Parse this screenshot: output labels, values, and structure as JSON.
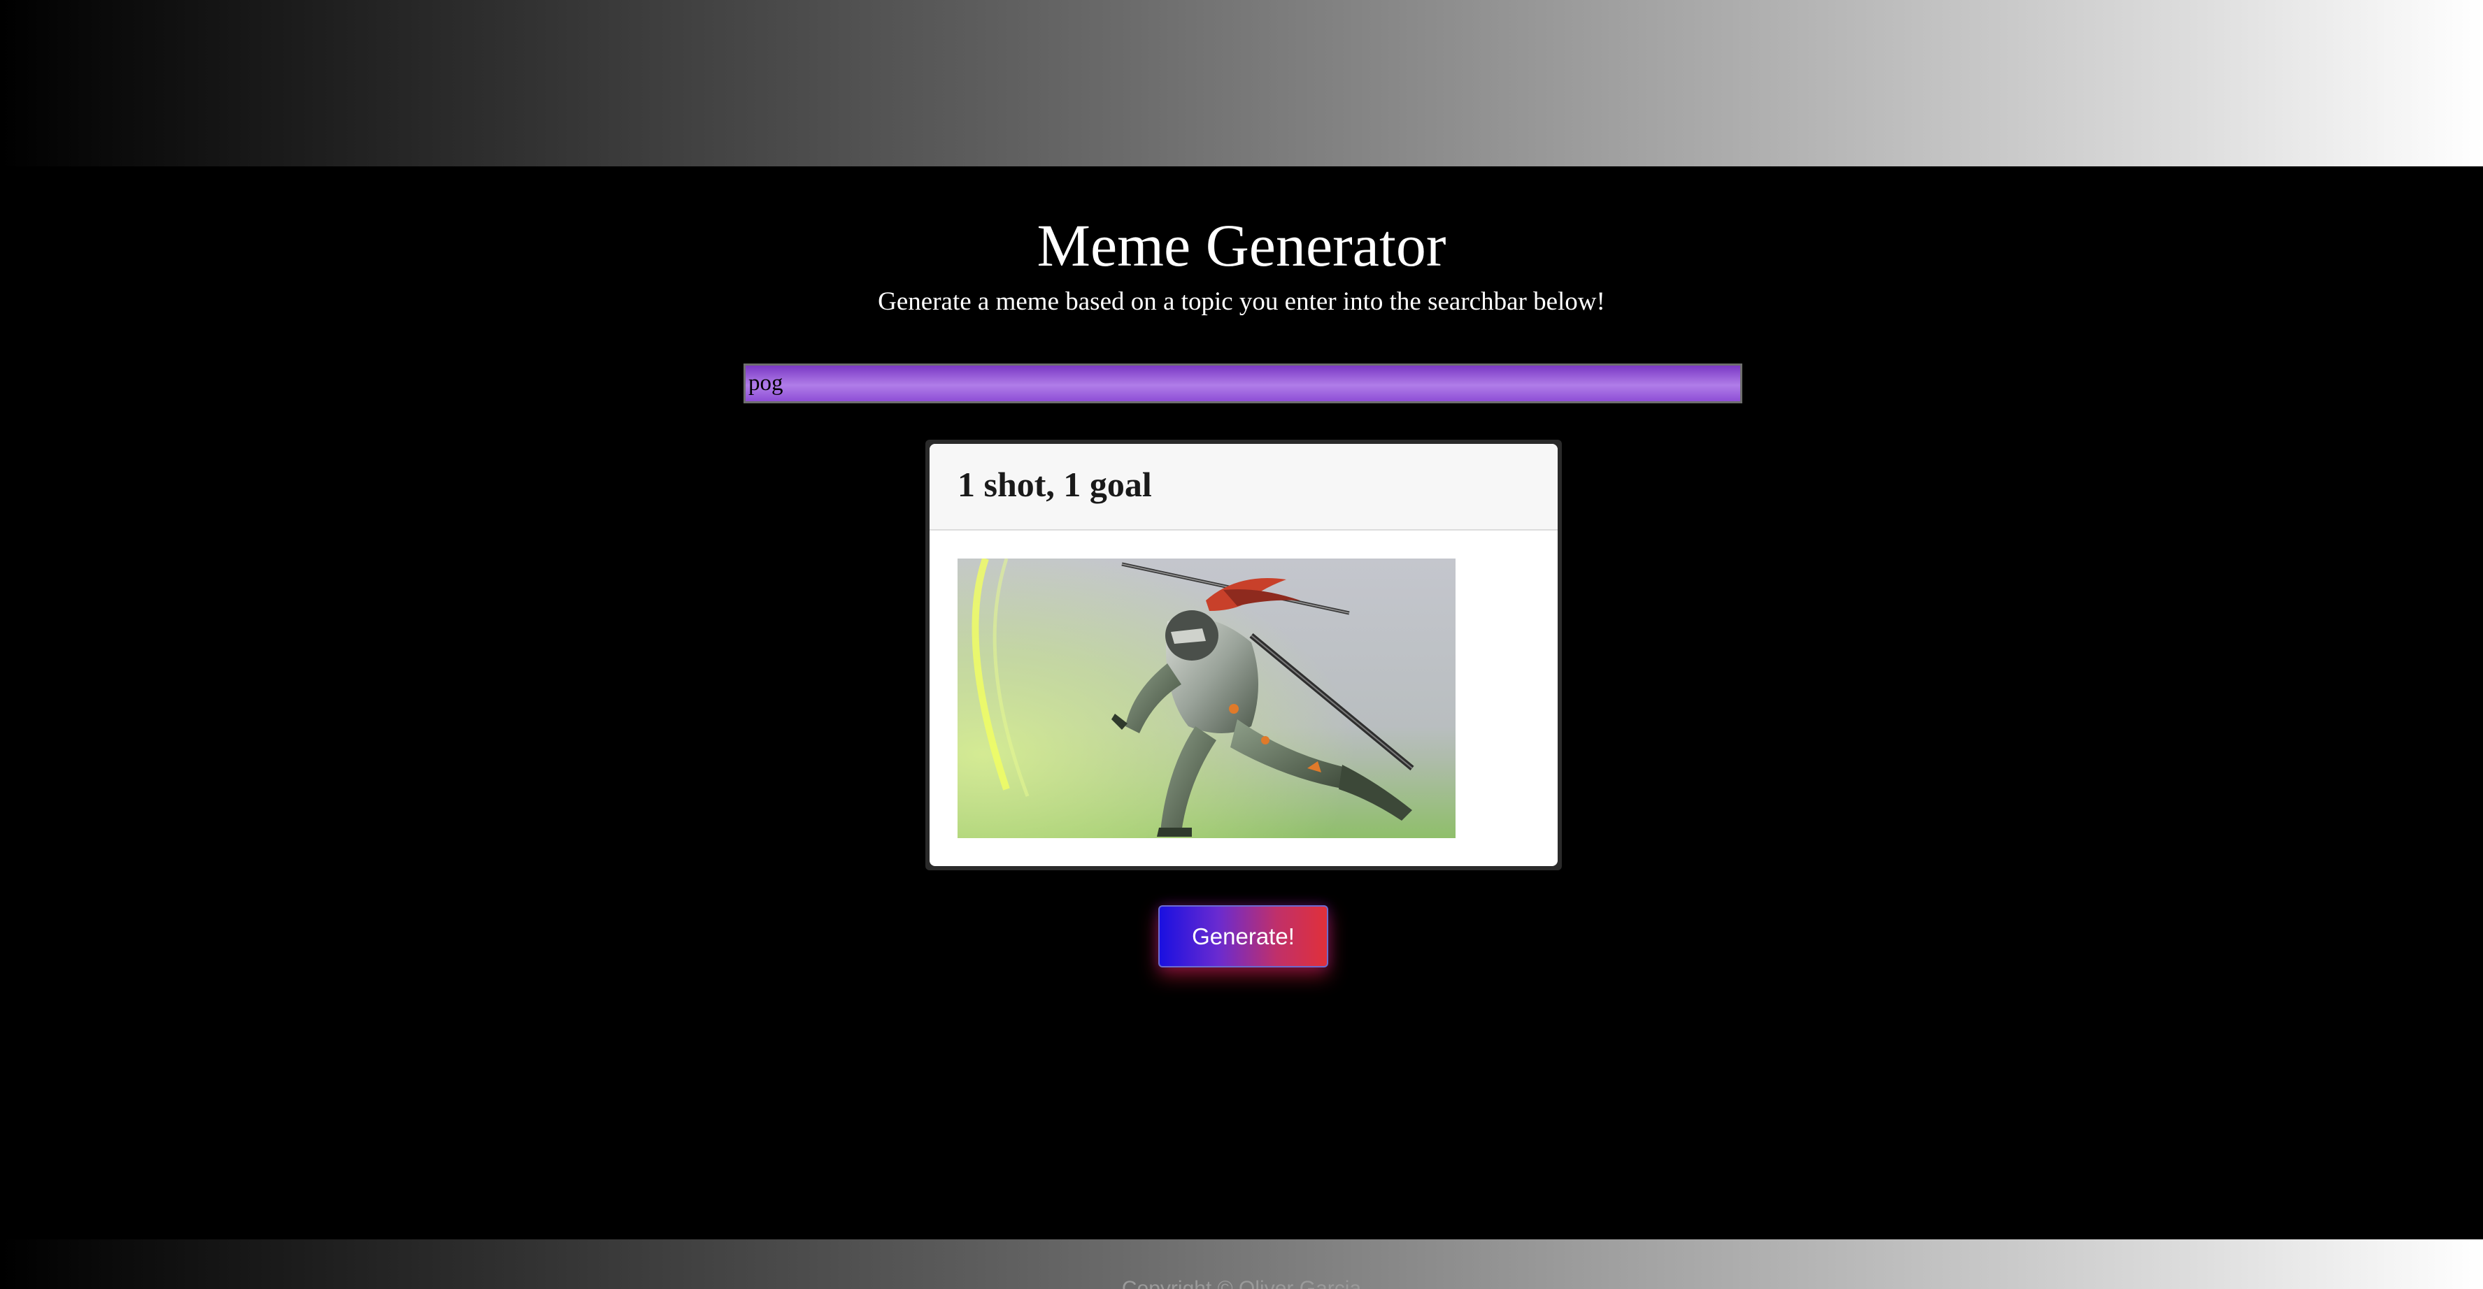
{
  "header": {
    "title": "Meme Generator",
    "subtitle": "Generate a meme based on a topic you enter into the searchbar below!"
  },
  "search": {
    "value": "pog",
    "placeholder": ""
  },
  "meme": {
    "title": "1 shot, 1 goal",
    "image_alt": "armored cyber ninja with sword lunging forward"
  },
  "actions": {
    "generate_label": "Generate!"
  },
  "footer": {
    "copyright": "Copyright © Oliver Garcia"
  },
  "colors": {
    "background": "#000000",
    "search_accent": "#a86be6",
    "button_start": "#1a10e0",
    "button_end": "#e0303a"
  }
}
